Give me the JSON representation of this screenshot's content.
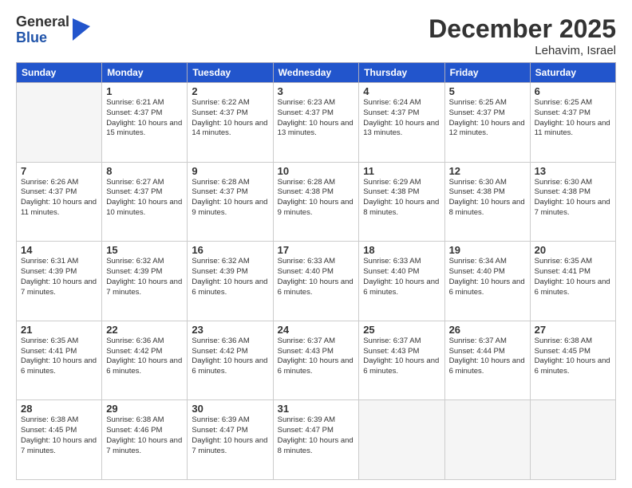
{
  "logo": {
    "general": "General",
    "blue": "Blue"
  },
  "title": "December 2025",
  "location": "Lehavim, Israel",
  "headers": [
    "Sunday",
    "Monday",
    "Tuesday",
    "Wednesday",
    "Thursday",
    "Friday",
    "Saturday"
  ],
  "weeks": [
    [
      {
        "day": "",
        "info": ""
      },
      {
        "day": "1",
        "info": "Sunrise: 6:21 AM\nSunset: 4:37 PM\nDaylight: 10 hours\nand 15 minutes."
      },
      {
        "day": "2",
        "info": "Sunrise: 6:22 AM\nSunset: 4:37 PM\nDaylight: 10 hours\nand 14 minutes."
      },
      {
        "day": "3",
        "info": "Sunrise: 6:23 AM\nSunset: 4:37 PM\nDaylight: 10 hours\nand 13 minutes."
      },
      {
        "day": "4",
        "info": "Sunrise: 6:24 AM\nSunset: 4:37 PM\nDaylight: 10 hours\nand 13 minutes."
      },
      {
        "day": "5",
        "info": "Sunrise: 6:25 AM\nSunset: 4:37 PM\nDaylight: 10 hours\nand 12 minutes."
      },
      {
        "day": "6",
        "info": "Sunrise: 6:25 AM\nSunset: 4:37 PM\nDaylight: 10 hours\nand 11 minutes."
      }
    ],
    [
      {
        "day": "7",
        "info": "Sunrise: 6:26 AM\nSunset: 4:37 PM\nDaylight: 10 hours\nand 11 minutes."
      },
      {
        "day": "8",
        "info": "Sunrise: 6:27 AM\nSunset: 4:37 PM\nDaylight: 10 hours\nand 10 minutes."
      },
      {
        "day": "9",
        "info": "Sunrise: 6:28 AM\nSunset: 4:37 PM\nDaylight: 10 hours\nand 9 minutes."
      },
      {
        "day": "10",
        "info": "Sunrise: 6:28 AM\nSunset: 4:38 PM\nDaylight: 10 hours\nand 9 minutes."
      },
      {
        "day": "11",
        "info": "Sunrise: 6:29 AM\nSunset: 4:38 PM\nDaylight: 10 hours\nand 8 minutes."
      },
      {
        "day": "12",
        "info": "Sunrise: 6:30 AM\nSunset: 4:38 PM\nDaylight: 10 hours\nand 8 minutes."
      },
      {
        "day": "13",
        "info": "Sunrise: 6:30 AM\nSunset: 4:38 PM\nDaylight: 10 hours\nand 7 minutes."
      }
    ],
    [
      {
        "day": "14",
        "info": "Sunrise: 6:31 AM\nSunset: 4:39 PM\nDaylight: 10 hours\nand 7 minutes."
      },
      {
        "day": "15",
        "info": "Sunrise: 6:32 AM\nSunset: 4:39 PM\nDaylight: 10 hours\nand 7 minutes."
      },
      {
        "day": "16",
        "info": "Sunrise: 6:32 AM\nSunset: 4:39 PM\nDaylight: 10 hours\nand 6 minutes."
      },
      {
        "day": "17",
        "info": "Sunrise: 6:33 AM\nSunset: 4:40 PM\nDaylight: 10 hours\nand 6 minutes."
      },
      {
        "day": "18",
        "info": "Sunrise: 6:33 AM\nSunset: 4:40 PM\nDaylight: 10 hours\nand 6 minutes."
      },
      {
        "day": "19",
        "info": "Sunrise: 6:34 AM\nSunset: 4:40 PM\nDaylight: 10 hours\nand 6 minutes."
      },
      {
        "day": "20",
        "info": "Sunrise: 6:35 AM\nSunset: 4:41 PM\nDaylight: 10 hours\nand 6 minutes."
      }
    ],
    [
      {
        "day": "21",
        "info": "Sunrise: 6:35 AM\nSunset: 4:41 PM\nDaylight: 10 hours\nand 6 minutes."
      },
      {
        "day": "22",
        "info": "Sunrise: 6:36 AM\nSunset: 4:42 PM\nDaylight: 10 hours\nand 6 minutes."
      },
      {
        "day": "23",
        "info": "Sunrise: 6:36 AM\nSunset: 4:42 PM\nDaylight: 10 hours\nand 6 minutes."
      },
      {
        "day": "24",
        "info": "Sunrise: 6:37 AM\nSunset: 4:43 PM\nDaylight: 10 hours\nand 6 minutes."
      },
      {
        "day": "25",
        "info": "Sunrise: 6:37 AM\nSunset: 4:43 PM\nDaylight: 10 hours\nand 6 minutes."
      },
      {
        "day": "26",
        "info": "Sunrise: 6:37 AM\nSunset: 4:44 PM\nDaylight: 10 hours\nand 6 minutes."
      },
      {
        "day": "27",
        "info": "Sunrise: 6:38 AM\nSunset: 4:45 PM\nDaylight: 10 hours\nand 6 minutes."
      }
    ],
    [
      {
        "day": "28",
        "info": "Sunrise: 6:38 AM\nSunset: 4:45 PM\nDaylight: 10 hours\nand 7 minutes."
      },
      {
        "day": "29",
        "info": "Sunrise: 6:38 AM\nSunset: 4:46 PM\nDaylight: 10 hours\nand 7 minutes."
      },
      {
        "day": "30",
        "info": "Sunrise: 6:39 AM\nSunset: 4:47 PM\nDaylight: 10 hours\nand 7 minutes."
      },
      {
        "day": "31",
        "info": "Sunrise: 6:39 AM\nSunset: 4:47 PM\nDaylight: 10 hours\nand 8 minutes."
      },
      {
        "day": "",
        "info": ""
      },
      {
        "day": "",
        "info": ""
      },
      {
        "day": "",
        "info": ""
      }
    ]
  ]
}
